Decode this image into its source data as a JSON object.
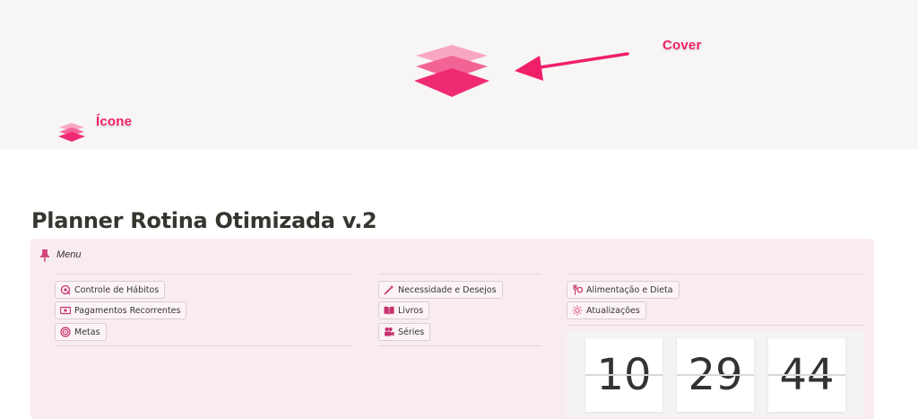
{
  "annotations": {
    "cover": "Cover",
    "icone": "Ícone"
  },
  "page": {
    "title": "Planner Rotina Otimizada v.2"
  },
  "callout": {
    "label": "Menu",
    "icon": "pin-icon"
  },
  "columns": [
    {
      "buttons": [
        {
          "label": "Controle de Hábitos",
          "icon": "habit-target-icon"
        },
        {
          "label": "Pagamentos Recorrentes",
          "icon": "money-icon"
        },
        {
          "label": "Metas",
          "icon": "goal-icon"
        }
      ]
    },
    {
      "buttons": [
        {
          "label": "Necessidade e Desejos",
          "icon": "magic-wand-icon"
        },
        {
          "label": "Livros",
          "icon": "book-icon"
        },
        {
          "label": "Séries",
          "icon": "film-icon"
        }
      ]
    },
    {
      "buttons": [
        {
          "label": "Alimentação e Dieta",
          "icon": "utensils-icon"
        },
        {
          "label": "Atualizações",
          "icon": "sparkle-icon"
        }
      ]
    }
  ],
  "clock": {
    "hours": "10",
    "minutes": "29",
    "seconds": "44"
  },
  "colors": {
    "accent": "#ef1f6a",
    "callout_bg": "#f9ecf1",
    "cover_bg": "#f7f6f5"
  }
}
